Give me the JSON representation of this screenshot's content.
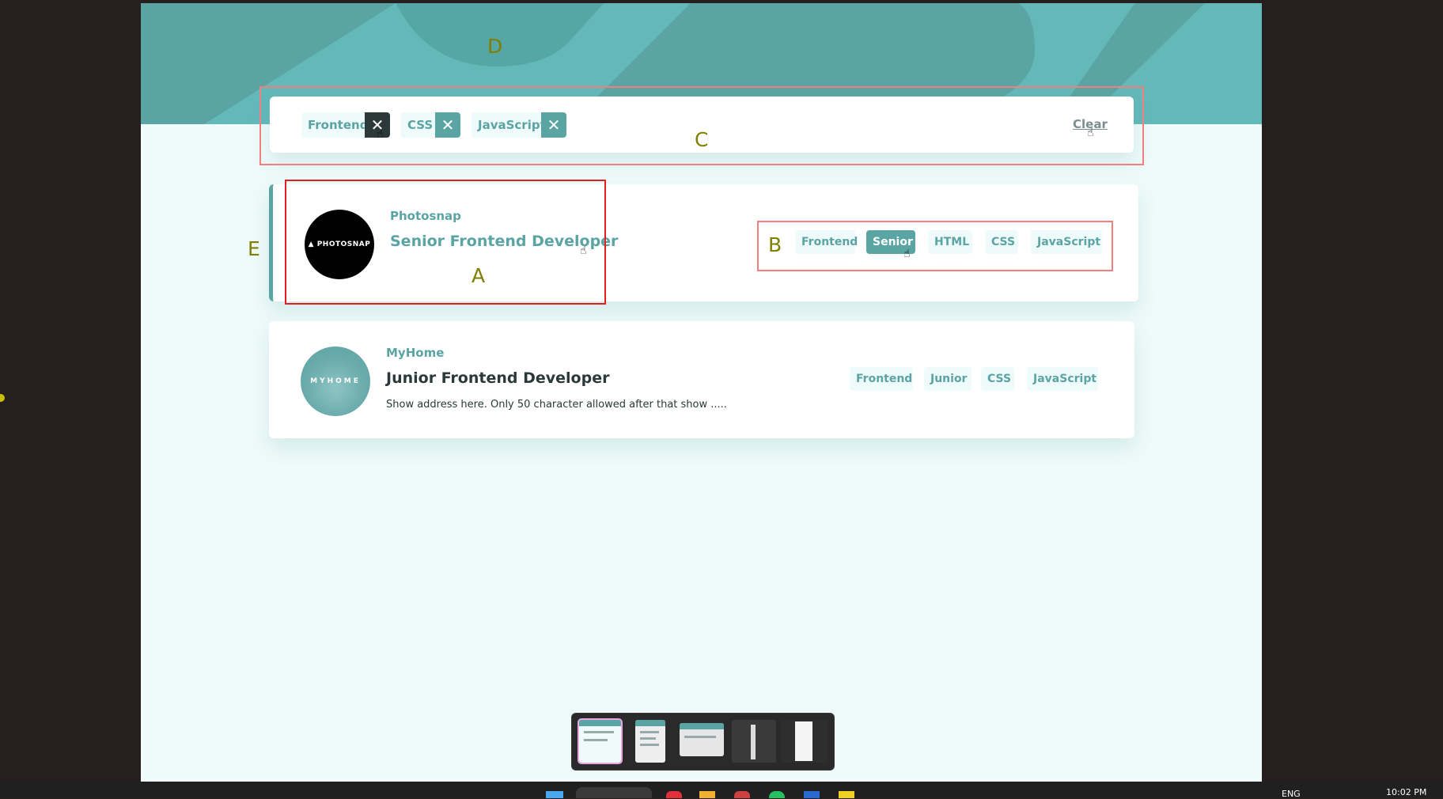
{
  "filters": {
    "chips": [
      "Frontend",
      "CSS",
      "JavaScript"
    ],
    "remove_symbol": "✕",
    "clear_label": "Clear"
  },
  "jobs": [
    {
      "company": "Photosnap",
      "position": "Senior Frontend Developer",
      "address": "",
      "logo_text": "▲ PHOTOSNAP",
      "tags": [
        "Frontend",
        "Senior",
        "HTML",
        "CSS",
        "JavaScript"
      ],
      "active_tag": "Senior"
    },
    {
      "company": "MyHome",
      "position": "Junior Frontend Developer",
      "address": "Show address here. Only 50 character allowed after that show .....",
      "logo_text": "MYHOME",
      "tags": [
        "Frontend",
        "Junior",
        "CSS",
        "JavaScript"
      ]
    }
  ],
  "annotations": [
    "A",
    "B",
    "C",
    "D",
    "E"
  ],
  "taskbar": {
    "language": "ENG",
    "time": "10:02 PM"
  },
  "colors": {
    "primary": "#5ba4a4",
    "background": "#effafa",
    "dark": "#2b3939",
    "annotation_red": "#e02020",
    "annotation_pink": "#f08080"
  }
}
